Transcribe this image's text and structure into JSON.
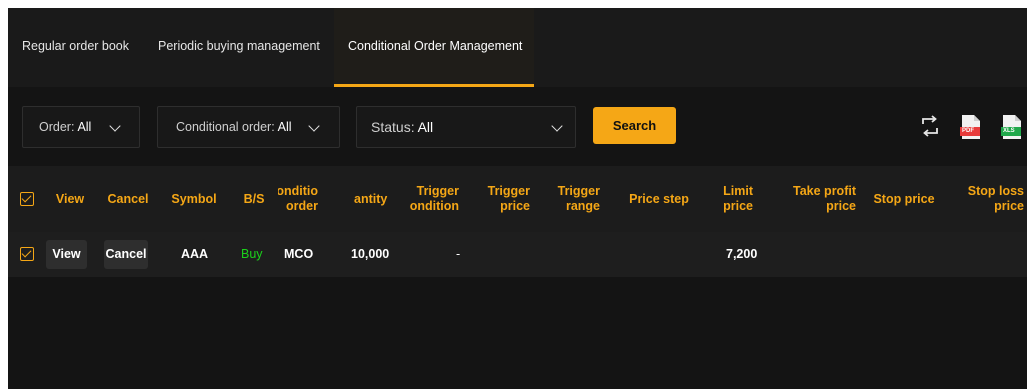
{
  "tabs": [
    {
      "label": "Regular order book",
      "active": false
    },
    {
      "label": "Periodic buying management",
      "active": false
    },
    {
      "label": "Conditional Order Management",
      "active": true
    }
  ],
  "filters": {
    "order": {
      "label": "Order:",
      "value": "All"
    },
    "conditional_order": {
      "label": "Conditional order:",
      "value": "All"
    },
    "status": {
      "label": "Status:",
      "value": "All"
    },
    "search_label": "Search"
  },
  "tools": {
    "pdf_badge": "PDF",
    "xls_badge": "XLS"
  },
  "colors": {
    "accent": "#f5a716",
    "buy": "#1bd11b",
    "background": "#141414"
  },
  "table": {
    "headers": {
      "view": "View",
      "cancel": "Cancel",
      "symbol": "Symbol",
      "bs": "B/S",
      "condition_order_1": "Conditio",
      "condition_order_2": "order",
      "quantity": "antity",
      "trigger_condition_1": "Trigger",
      "trigger_condition_2": "ondition",
      "trigger_price_1": "Trigger",
      "trigger_price_2": "price",
      "trigger_range_1": "Trigger",
      "trigger_range_2": "range",
      "price_step": "Price step",
      "limit_price_1": "Limit",
      "limit_price_2": "price",
      "take_profit_1": "Take profit",
      "take_profit_2": "price",
      "stop_price": "Stop price",
      "stop_loss_1": "Stop loss",
      "stop_loss_2": "price"
    },
    "rows": [
      {
        "view": "View",
        "cancel": "Cancel",
        "symbol": "AAA",
        "bs": "Buy",
        "condition_order": "MCO",
        "quantity": "10,000",
        "trigger_condition": "-",
        "trigger_price": "",
        "trigger_range": "",
        "price_step": "",
        "limit_price": "7,200",
        "take_profit_price": "",
        "stop_price": "",
        "stop_loss_price": ""
      }
    ]
  }
}
